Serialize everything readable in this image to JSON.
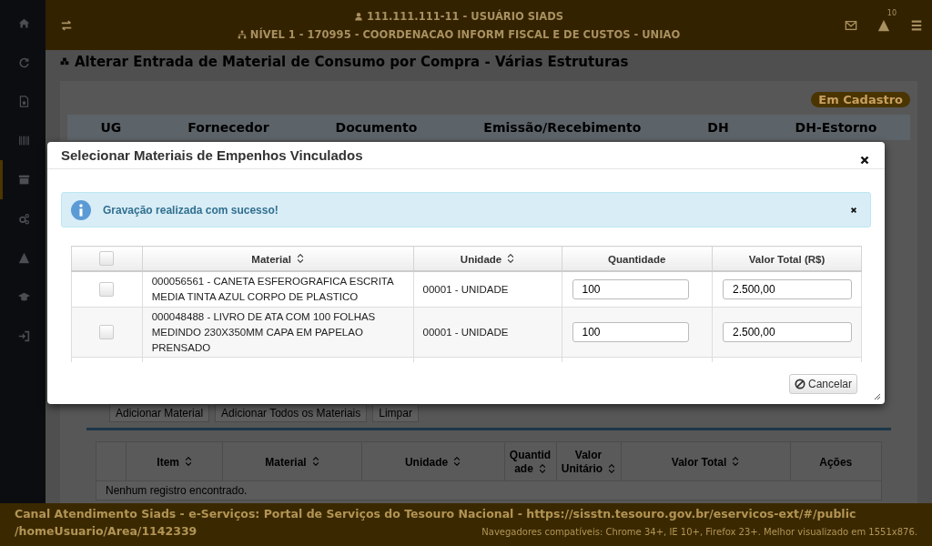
{
  "header": {
    "user": "111.111.111-11 - USUÁRIO SIADS",
    "unit": "NÍVEL 1 - 170995 - COORDENACAO INFORM FISCAL E DE CUSTOS - UNIAO",
    "notification_count": "10"
  },
  "sidebar": {
    "items": [
      {
        "kind": "home",
        "selected": false
      },
      {
        "kind": "refresh",
        "selected": false
      },
      {
        "kind": "file",
        "selected": false
      },
      {
        "kind": "barcode",
        "selected": false
      },
      {
        "kind": "archive",
        "selected": true
      },
      {
        "kind": "cogs",
        "selected": false
      },
      {
        "kind": "warning",
        "selected": false
      },
      {
        "kind": "cap",
        "selected": false
      },
      {
        "kind": "signin",
        "selected": false
      }
    ]
  },
  "page": {
    "title": "Alterar Entrada de Material de Consumo por Compra - Várias Estruturas",
    "status": "Em Cadastro",
    "summary_columns": [
      "UG",
      "Fornecedor",
      "Documento",
      "Emissão/Recebimento",
      "DH",
      "DH-Estorno"
    ],
    "buttons": [
      "Adicionar Material",
      "Adicionar Todos os Materiais",
      "Limpar"
    ],
    "items_table": {
      "columns": [
        {
          "sortable": false
        },
        {
          "label": "Item",
          "sortable": true
        },
        {
          "label": "Material",
          "sortable": true
        },
        {
          "label": "Unidade",
          "sortable": true
        },
        {
          "label": "Quantidade",
          "sortable": true
        },
        {
          "label": "Valor Unitário",
          "sortable": true
        },
        {
          "label": "Valor Total",
          "sortable": true
        },
        {
          "label": "Ações",
          "sortable": false
        }
      ],
      "empty_message": "Nenhum registro encontrado."
    }
  },
  "modal": {
    "title": "Selecionar Materiais de Empenhos Vinculados",
    "alert": "Gravação realizada com sucesso!",
    "all_checked": false,
    "columns": [
      {
        "label": "Material",
        "sortable": true
      },
      {
        "label": "Unidade",
        "sortable": true
      },
      {
        "label": "Quantidade",
        "sortable": false
      },
      {
        "label": "Valor Total (R$)",
        "sortable": false
      }
    ],
    "rows": [
      {
        "checked": false,
        "material": "000056561 - CANETA ESFEROGRAFICA ESCRITA MEDIA TINTA AZUL CORPO DE PLASTICO",
        "unit": "00001 - UNIDADE",
        "quantity": "100",
        "total": "2.500,00"
      },
      {
        "checked": false,
        "material": "000048488 - LIVRO DE ATA COM 100 FOLHAS MEDINDO 230X350MM CAPA EM PAPELAO PRENSADO",
        "unit": "00001 - UNIDADE",
        "quantity": "100",
        "total": "2.500,00"
      }
    ],
    "cancel_button": "Cancelar"
  },
  "footer": {
    "channel": "Canal Atendimento Siads - e-Serviços: Portal de Serviços do Tesouro Nacional - https://sisstn.tesouro.gov.br/eservicos-ext/#/public",
    "channel_path": "/homeUsuario/Area/1142339",
    "browsers": "Navegadores compatíveis: Chrome 34+, IE 10+, Firefox 23+. Melhor visualizado em 1551x876."
  }
}
